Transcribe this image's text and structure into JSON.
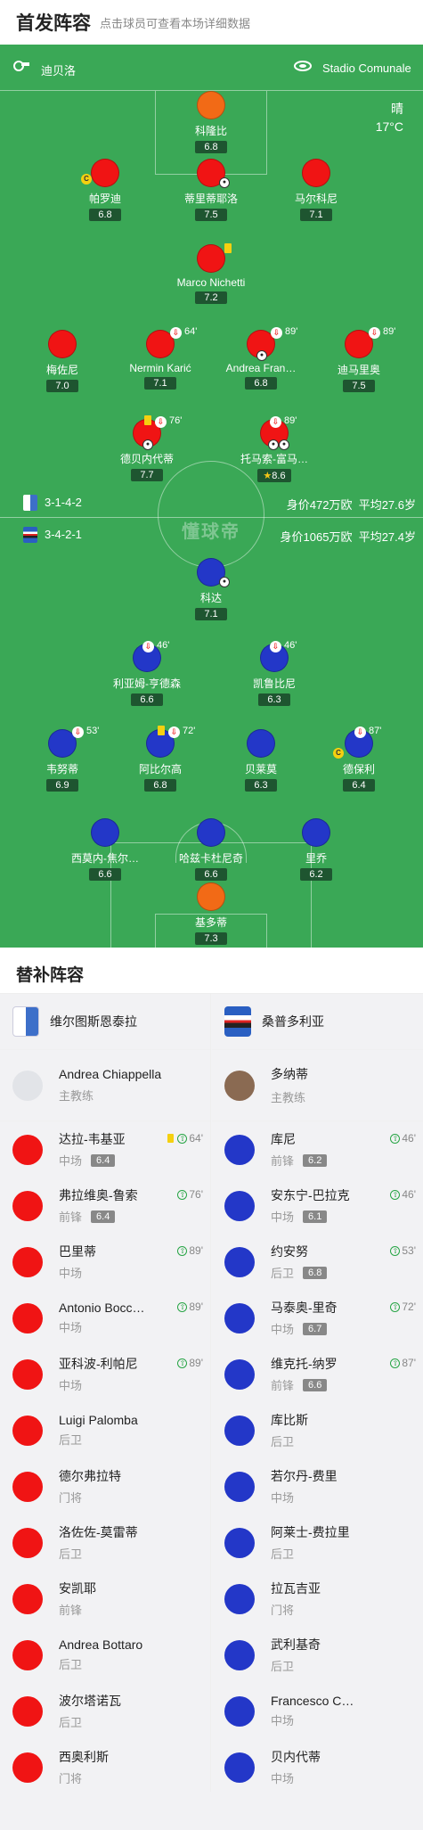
{
  "header": {
    "title": "首发阵容",
    "subtitle": "点击球员可查看本场详细数据"
  },
  "venue": {
    "referee": "迪贝洛",
    "stadium": "Stadio Comunale",
    "weather": "晴",
    "temperature": "17°C"
  },
  "home_team": {
    "formation": "3-1-4-2",
    "value": "身价472万欧",
    "avg_age": "平均27.6岁"
  },
  "away_team": {
    "formation": "3-4-2-1",
    "value": "身价1065万欧",
    "avg_age": "平均27.4岁"
  },
  "logo_text": "懂球帝",
  "home_players": [
    {
      "name": "科隆比",
      "rating": "6.8"
    },
    {
      "name": "帕罗迪",
      "rating": "6.8"
    },
    {
      "name": "蒂里蒂耶洛",
      "rating": "7.5"
    },
    {
      "name": "马尔科尼",
      "rating": "7.1"
    },
    {
      "name": "Marco Nichetti",
      "rating": "7.2"
    },
    {
      "name": "梅佐尼",
      "rating": "7.0"
    },
    {
      "name": "Nermin Karić",
      "rating": "7.1",
      "sub_min": "64'"
    },
    {
      "name": "Andrea Fran…",
      "rating": "6.8",
      "sub_min": "89'"
    },
    {
      "name": "迪马里奥",
      "rating": "7.5",
      "sub_min": "89'"
    },
    {
      "name": "德贝内代蒂",
      "rating": "7.7",
      "sub_min": "76'"
    },
    {
      "name": "托马索-富马…",
      "rating": "8.6",
      "sub_min": "89'"
    }
  ],
  "away_players": [
    {
      "name": "科达",
      "rating": "7.1"
    },
    {
      "name": "利亚姆-亨德森",
      "rating": "6.6",
      "sub_min": "46'"
    },
    {
      "name": "凯鲁比尼",
      "rating": "6.3",
      "sub_min": "46'"
    },
    {
      "name": "韦努蒂",
      "rating": "6.9",
      "sub_min": "53'"
    },
    {
      "name": "阿比尔高",
      "rating": "6.8",
      "sub_min": "72'"
    },
    {
      "name": "贝莱莫",
      "rating": "6.3"
    },
    {
      "name": "德保利",
      "rating": "6.4",
      "sub_min": "87'"
    },
    {
      "name": "西莫内-焦尔…",
      "rating": "6.6"
    },
    {
      "name": "哈兹卡杜尼奇",
      "rating": "6.6"
    },
    {
      "name": "里乔",
      "rating": "6.2"
    },
    {
      "name": "基多蒂",
      "rating": "7.3"
    }
  ],
  "subs": {
    "title": "替补阵容",
    "home": {
      "team": "维尔图斯恩泰拉",
      "coach": {
        "name": "Andrea Chiappella",
        "role": "主教练"
      },
      "players": [
        {
          "name": "达拉-韦基亚",
          "pos": "中场",
          "rating": "6.4",
          "min": "64'"
        },
        {
          "name": "弗拉维奥-鲁索",
          "pos": "前锋",
          "rating": "6.4",
          "min": "76'"
        },
        {
          "name": "巴里蒂",
          "pos": "中场",
          "min": "89'"
        },
        {
          "name": "Antonio Bocc…",
          "pos": "中场",
          "min": "89'"
        },
        {
          "name": "亚科波-利帕尼",
          "pos": "中场",
          "min": "89'"
        },
        {
          "name": "Luigi Palomba",
          "pos": "后卫"
        },
        {
          "name": "德尔弗拉特",
          "pos": "门将"
        },
        {
          "name": "洛佐佐-莫雷蒂",
          "pos": "后卫"
        },
        {
          "name": "安凯耶",
          "pos": "前锋"
        },
        {
          "name": "Andrea Bottaro",
          "pos": "后卫"
        },
        {
          "name": "波尔塔诺瓦",
          "pos": "后卫"
        },
        {
          "name": "西奥利斯",
          "pos": "门将"
        }
      ]
    },
    "away": {
      "team": "桑普多利亚",
      "coach": {
        "name": "多纳蒂",
        "role": "主教练"
      },
      "players": [
        {
          "name": "库尼",
          "pos": "前锋",
          "rating": "6.2",
          "min": "46'"
        },
        {
          "name": "安东宁-巴拉克",
          "pos": "中场",
          "rating": "6.1",
          "min": "46'"
        },
        {
          "name": "约安努",
          "pos": "后卫",
          "rating": "6.8",
          "min": "53'"
        },
        {
          "name": "马泰奥-里奇",
          "pos": "中场",
          "rating": "6.7",
          "min": "72'"
        },
        {
          "name": "维克托-纳罗",
          "pos": "前锋",
          "rating": "6.6",
          "min": "87'"
        },
        {
          "name": "库比斯",
          "pos": "后卫"
        },
        {
          "name": "若尔丹-费里",
          "pos": "中场"
        },
        {
          "name": "阿莱士-费拉里",
          "pos": "后卫"
        },
        {
          "name": "拉瓦吉亚",
          "pos": "门将"
        },
        {
          "name": "武利基奇",
          "pos": "后卫"
        },
        {
          "name": "Francesco C…",
          "pos": "中场"
        },
        {
          "name": "贝内代蒂",
          "pos": "中场"
        }
      ]
    }
  },
  "colors": {
    "pitch": "#3aa856",
    "home": "#f01414",
    "away": "#2337c8",
    "gk": "#f26a16"
  }
}
